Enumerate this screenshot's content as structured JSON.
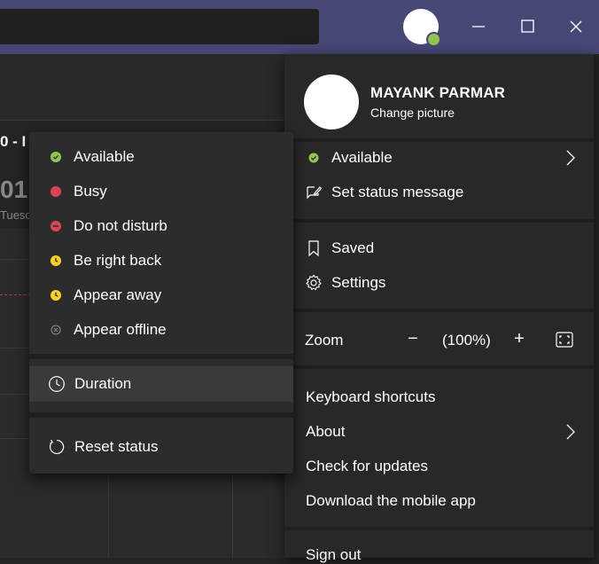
{
  "window": {
    "minimize_label": "—",
    "maximize_label": "☐",
    "close_label": "✕"
  },
  "background": {
    "date_range": "0 - I",
    "day_number": "01",
    "day_name": "Tuesc"
  },
  "profile": {
    "name": "MAYANK PARMAR",
    "change_picture": "Change picture",
    "status": "Available",
    "set_status_message": "Set status message",
    "saved": "Saved",
    "settings": "Settings",
    "zoom_label": "Zoom",
    "zoom_minus": "−",
    "zoom_value": "(100%)",
    "zoom_plus": "+",
    "keyboard_shortcuts": "Keyboard shortcuts",
    "about": "About",
    "check_for_updates": "Check for updates",
    "download_mobile_app": "Download the mobile app",
    "sign_out": "Sign out"
  },
  "status_menu": {
    "items": [
      {
        "label": "Available",
        "color": "#92c353",
        "icon": "check-dot-icon"
      },
      {
        "label": "Busy",
        "color": "#d74654",
        "icon": "busy-dot-icon"
      },
      {
        "label": "Do not disturb",
        "color": "#d74654",
        "icon": "dnd-dot-icon"
      },
      {
        "label": "Be right back",
        "color": "#f8d22a",
        "icon": "clock-dot-icon"
      },
      {
        "label": "Appear away",
        "color": "#f8d22a",
        "icon": "clock-dot-icon"
      },
      {
        "label": "Appear offline",
        "color": "#8a8886",
        "icon": "offline-x-icon"
      }
    ],
    "duration": "Duration",
    "reset_status": "Reset status"
  },
  "colors": {
    "titlebar": "#464775",
    "available": "#92c353",
    "busy": "#d74654",
    "away": "#f8d22a",
    "panel_bg": "#292828",
    "menu_bg": "#2d2c2c"
  }
}
